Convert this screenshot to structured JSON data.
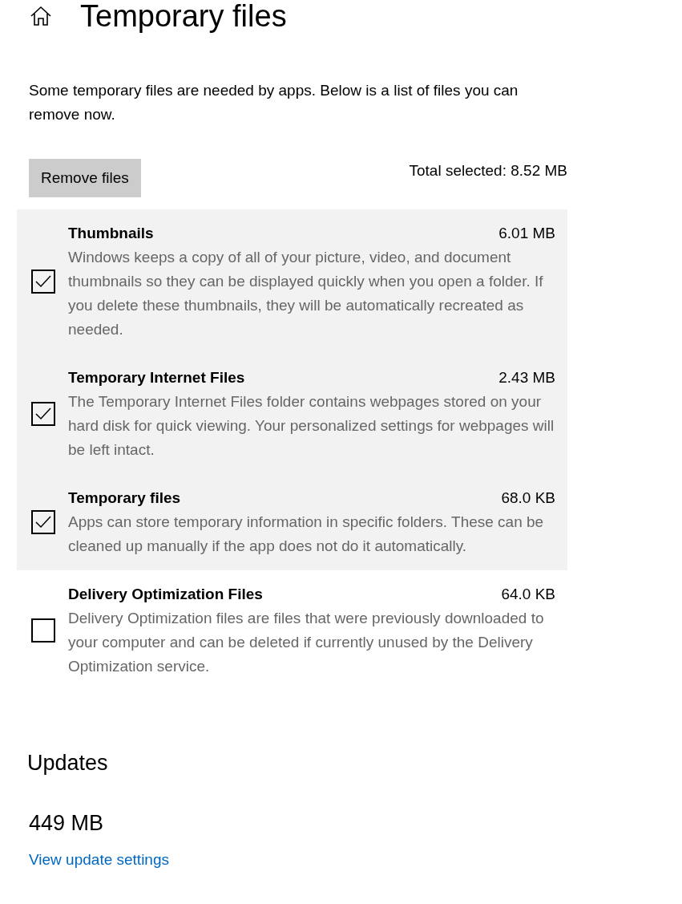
{
  "header": {
    "title": "Temporary files"
  },
  "description": "Some temporary files are needed by apps. Below is a list of files you can remove now.",
  "remove_button": "Remove files",
  "total_selected": "Total selected: 8.52 MB",
  "items": [
    {
      "title": "Thumbnails",
      "size": "6.01 MB",
      "description": "Windows keeps a copy of all of your picture, video, and document thumbnails so they can be displayed quickly when you open a folder. If you delete these thumbnails, they will be automatically recreated as needed.",
      "checked": true
    },
    {
      "title": "Temporary Internet Files",
      "size": "2.43 MB",
      "description": "The Temporary Internet Files folder contains webpages stored on your hard disk for quick viewing. Your personalized settings for webpages will be left intact.",
      "checked": true
    },
    {
      "title": "Temporary files",
      "size": "68.0 KB",
      "description": "Apps can store temporary information in specific folders. These can be cleaned up manually if the app does not do it automatically.",
      "checked": true
    },
    {
      "title": "Delivery Optimization Files",
      "size": "64.0 KB",
      "description": "Delivery Optimization files are files that were previously downloaded to your computer and can be deleted if currently unused by the Delivery Optimization service.",
      "checked": false
    }
  ],
  "updates": {
    "heading": "Updates",
    "size": "449 MB",
    "link": "View update settings"
  }
}
